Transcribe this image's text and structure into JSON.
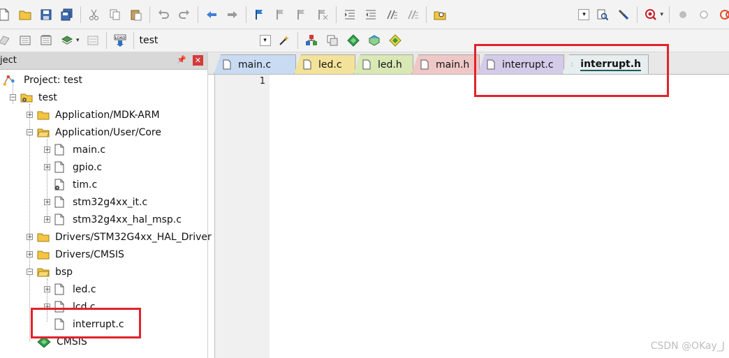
{
  "colors": {
    "accent_red": "#e2222a",
    "tab_main_c": "#c9dbf3",
    "tab_led_c": "#f3e39a",
    "tab_led_h": "#d9e8b5",
    "tab_main_h": "#f0c7c7",
    "tab_interrupt_c": "#d4cbe9",
    "tab_interrupt_h": "#e6eef0"
  },
  "toolbar2": {
    "target_name": "test"
  },
  "project_panel": {
    "title": "oject",
    "tree": [
      {
        "label": "Project: test",
        "kind": "project",
        "depth": 0
      },
      {
        "label": "test",
        "kind": "target",
        "depth": 1,
        "expanded": true
      },
      {
        "label": "Application/MDK-ARM",
        "kind": "folder",
        "depth": 2,
        "expanded": false
      },
      {
        "label": "Application/User/Core",
        "kind": "folder",
        "depth": 2,
        "expanded": true
      },
      {
        "label": "main.c",
        "kind": "file",
        "depth": 3
      },
      {
        "label": "gpio.c",
        "kind": "file",
        "depth": 3
      },
      {
        "label": "tim.c",
        "kind": "file-gear",
        "depth": 3
      },
      {
        "label": "stm32g4xx_it.c",
        "kind": "file",
        "depth": 3
      },
      {
        "label": "stm32g4xx_hal_msp.c",
        "kind": "file",
        "depth": 3
      },
      {
        "label": "Drivers/STM32G4xx_HAL_Driver",
        "kind": "folder",
        "depth": 2,
        "expanded": false
      },
      {
        "label": "Drivers/CMSIS",
        "kind": "folder",
        "depth": 2,
        "expanded": false
      },
      {
        "label": "bsp",
        "kind": "folder",
        "depth": 2,
        "expanded": true
      },
      {
        "label": "led.c",
        "kind": "file",
        "depth": 3
      },
      {
        "label": "lcd.c",
        "kind": "file",
        "depth": 3
      },
      {
        "label": "interrupt.c",
        "kind": "file",
        "depth": 3
      },
      {
        "label": "CMSIS",
        "kind": "component",
        "depth": 2
      }
    ]
  },
  "tabs": [
    {
      "label": "main.c"
    },
    {
      "label": "led.c"
    },
    {
      "label": "led.h"
    },
    {
      "label": "main.h"
    },
    {
      "label": "interrupt.c"
    },
    {
      "label": "interrupt.h",
      "active": true
    }
  ],
  "editor": {
    "line_numbers": [
      "1"
    ]
  },
  "watermark": "CSDN @OKay_J"
}
